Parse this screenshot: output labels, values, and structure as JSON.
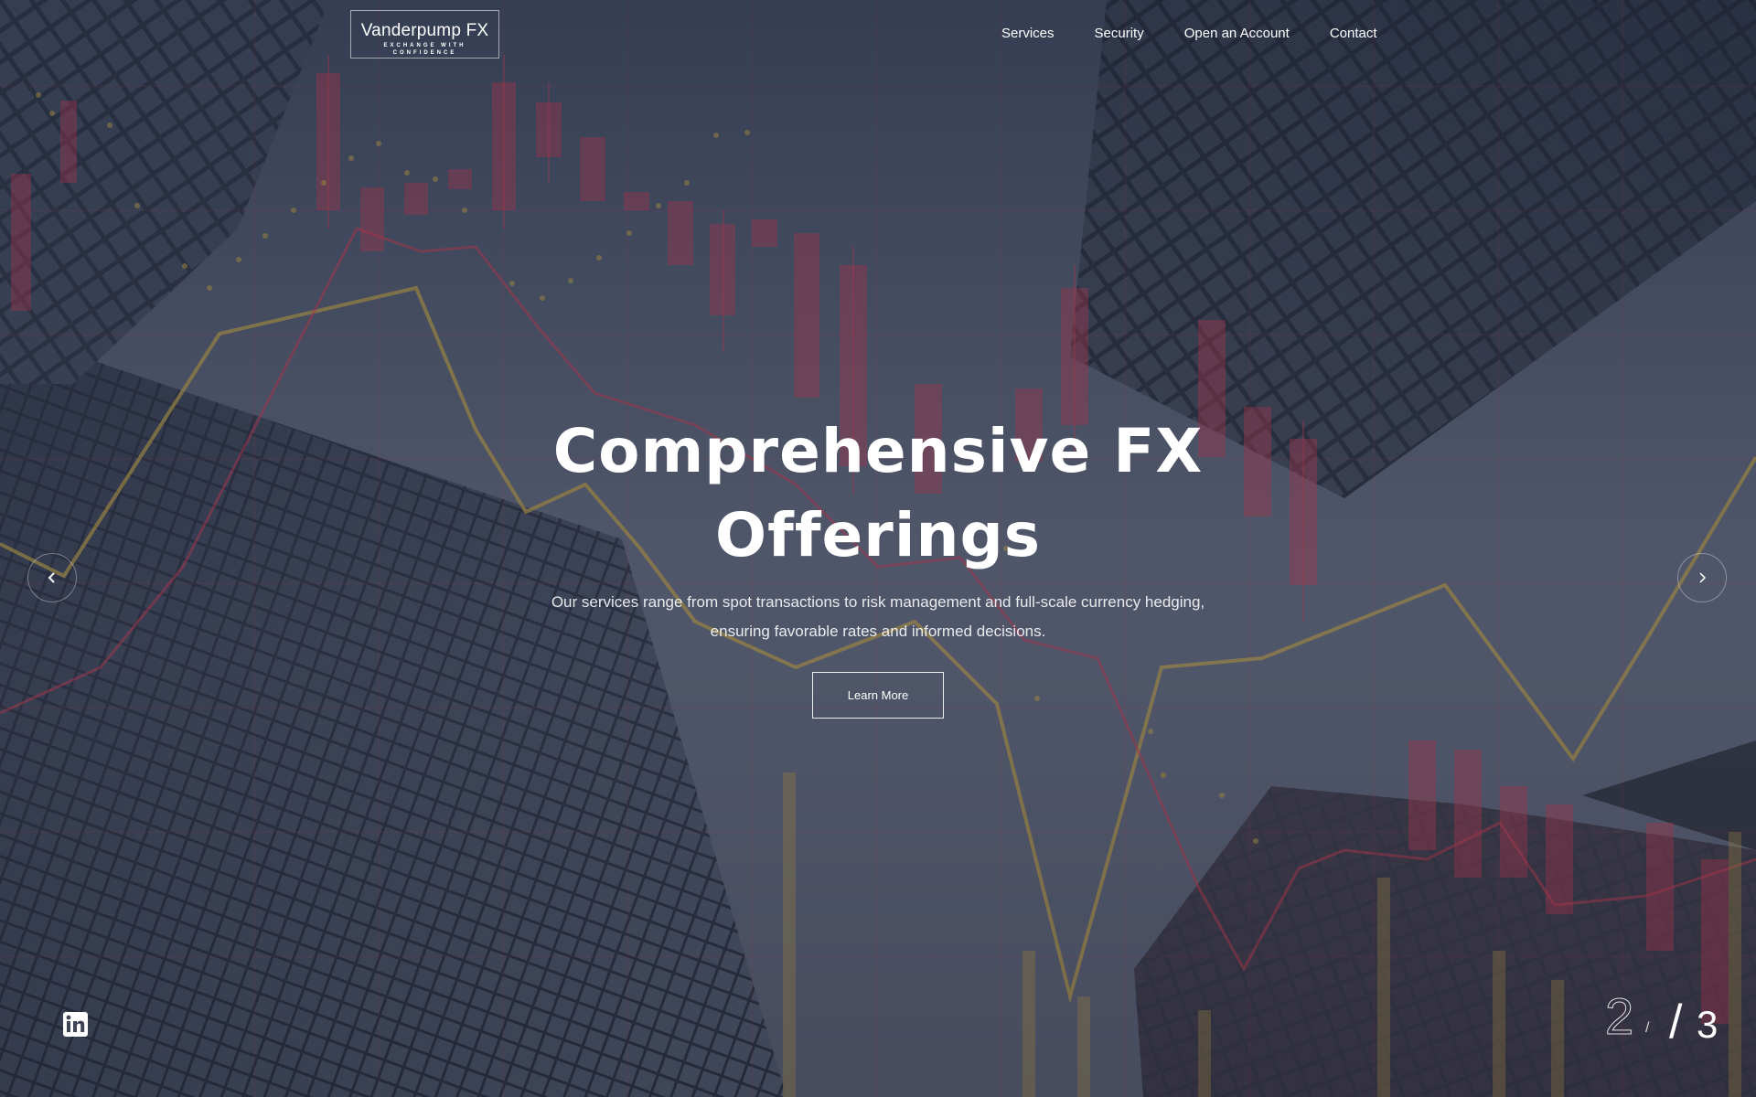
{
  "brand": {
    "name": "Vanderpump FX",
    "tagline": "EXCHANGE WITH CONFIDENCE"
  },
  "nav": {
    "items": [
      {
        "label": "Services"
      },
      {
        "label": "Security"
      },
      {
        "label": "Open an Account"
      },
      {
        "label": "Contact"
      }
    ]
  },
  "hero": {
    "headline_line1": "Comprehensive FX",
    "headline_line2": "Offerings",
    "subtitle_line1": "Our services range from spot transactions to risk management and full-scale currency hedging,",
    "subtitle_line2": "ensuring favorable rates and informed decisions.",
    "cta_label": "Learn More"
  },
  "slider": {
    "current": "2",
    "separator": "/",
    "total": "3"
  },
  "icons": {
    "prev": "chevron-left-icon",
    "next": "chevron-right-icon",
    "social": "linkedin-icon"
  },
  "colors": {
    "accent_red": "#d2334a",
    "accent_yellow": "#c8a53a",
    "overlay": "#3e4558"
  }
}
